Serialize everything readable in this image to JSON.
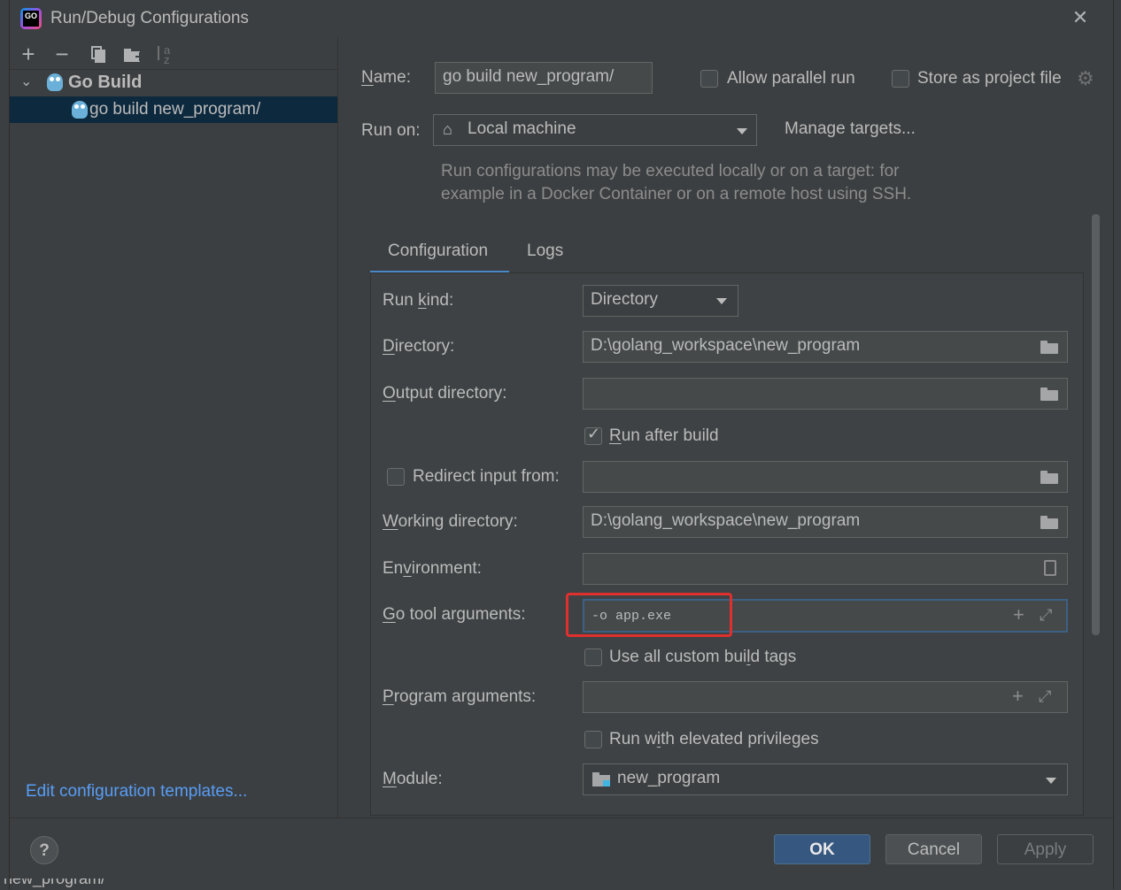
{
  "window": {
    "title": "Run/Debug Configurations",
    "close_glyph": "✕"
  },
  "left": {
    "toolbar": [
      {
        "icon": "add-icon",
        "glyph": "+"
      },
      {
        "icon": "remove-icon",
        "glyph": "−"
      },
      {
        "icon": "copy-icon",
        "glyph": "⧉"
      },
      {
        "icon": "new-folder-icon",
        "glyph": "📁"
      },
      {
        "icon": "sort-icon",
        "glyph": "⇅"
      }
    ],
    "tree": {
      "group_label": "Go Build",
      "item_label": "go build new_program/"
    },
    "edit_templates": "Edit configuration templates..."
  },
  "header": {
    "name_label": "Name:",
    "name_value": "go build new_program/",
    "allow_parallel": "Allow parallel run",
    "store_project": "Store as project file",
    "run_on_label": "Run on:",
    "run_on_value": "Local machine",
    "manage_targets": "Manage targets...",
    "hint_line1": "Run configurations may be executed locally or on a target: for",
    "hint_line2": "example in a Docker Container or on a remote host using SSH."
  },
  "tabs": [
    {
      "label": "Configuration",
      "active": true
    },
    {
      "label": "Logs",
      "active": false
    }
  ],
  "form": {
    "run_kind_label": "Run kind:",
    "run_kind_value": "Directory",
    "directory_label": "Directory:",
    "directory_value": "D:\\golang_workspace\\new_program",
    "output_label": "Output directory:",
    "output_value": "",
    "run_after_build": "Run after build",
    "redirect_label": "Redirect input from:",
    "working_dir_label": "Working directory:",
    "working_dir_value": "D:\\golang_workspace\\new_program",
    "env_label": "Environment:",
    "env_value": "",
    "go_tool_label": "Go tool arguments:",
    "go_tool_value": "-o app.exe",
    "custom_tags": "Use all custom build tags",
    "program_args_label": "Program arguments:",
    "elevated": "Run with elevated privileges",
    "module_label": "Module:",
    "module_value": "new_program"
  },
  "buttons": {
    "ok": "OK",
    "cancel": "Cancel",
    "apply": "Apply",
    "help": "?"
  },
  "background_text": "new_program/",
  "colors": {
    "accent": "#365880",
    "link": "#589df6",
    "highlight_box": "#e0302e",
    "selection": "#0d293e"
  }
}
